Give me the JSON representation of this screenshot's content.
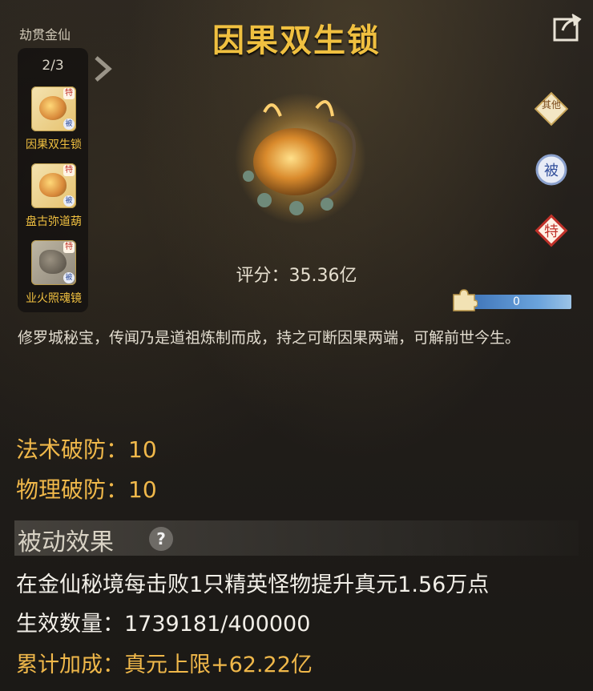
{
  "rank_label": "劫贯金仙",
  "title": "因果双生锁",
  "page_indicator": "2/3",
  "items": [
    {
      "name": "因果双生锁",
      "badge_te": "特",
      "badge_bei": "被"
    },
    {
      "name": "盘古弥道葫",
      "badge_te": "特",
      "badge_bei": "被"
    },
    {
      "name": "业火照魂镜",
      "badge_te": "特",
      "badge_bei": "被"
    }
  ],
  "score_label": "评分：35.36亿",
  "progress": {
    "value": "0",
    "fill": 0
  },
  "tags": [
    {
      "label": "其他",
      "icon": "other-tag-icon"
    },
    {
      "label": "被",
      "icon": "passive-tag-icon"
    },
    {
      "label": "特",
      "icon": "special-tag-icon"
    }
  ],
  "description": "修罗城秘宝，传闻乃是道祖炼制而成，持之可断因果两端，可解前世今生。",
  "stats": [
    {
      "key": "法术破防",
      "sep": "：",
      "value": "10"
    },
    {
      "key": "物理破防",
      "sep": "：",
      "value": "10"
    }
  ],
  "passive": {
    "section_title": "被动效果",
    "help": "?",
    "effect": "在金仙秘境每击败1只精英怪物提升真元1.56万点",
    "count_label": "生效数量：",
    "count_value": "1739181/400000",
    "bonus_label": "累计加成：",
    "bonus_value": "真元上限+62.22亿"
  },
  "colors": {
    "gold": "#f0c040",
    "stat": "#f0b84a",
    "progress": "#4f88c8"
  }
}
